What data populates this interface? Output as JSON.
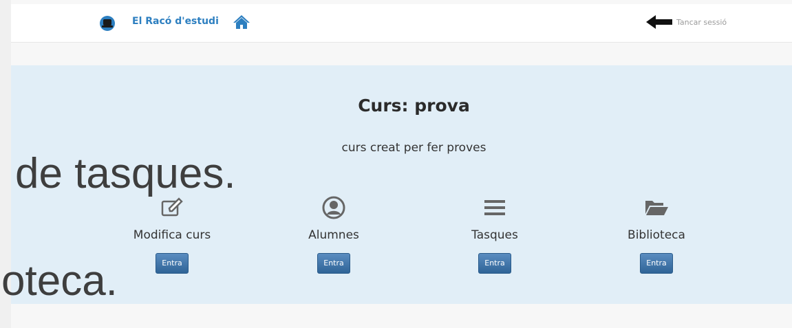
{
  "navbar": {
    "brand": "El Racó d'estudi",
    "logout_label": "Tancar sessió"
  },
  "course": {
    "title": "Curs: prova",
    "description": "curs creat per fer proves"
  },
  "tiles": [
    {
      "label": "Modifica curs",
      "button": "Entra",
      "icon": "edit-icon"
    },
    {
      "label": "Alumnes",
      "button": "Entra",
      "icon": "user-circle-icon"
    },
    {
      "label": "Tasques",
      "button": "Entra",
      "icon": "list-icon"
    },
    {
      "label": "Biblioteca",
      "button": "Entra",
      "icon": "folder-open-icon"
    }
  ],
  "overlay": {
    "line1": "de tasques.",
    "line2": "oteca."
  },
  "colors": {
    "brand": "#2d7fc0",
    "jumbotron": "#e1eef7",
    "button": "#3b6fa3"
  }
}
